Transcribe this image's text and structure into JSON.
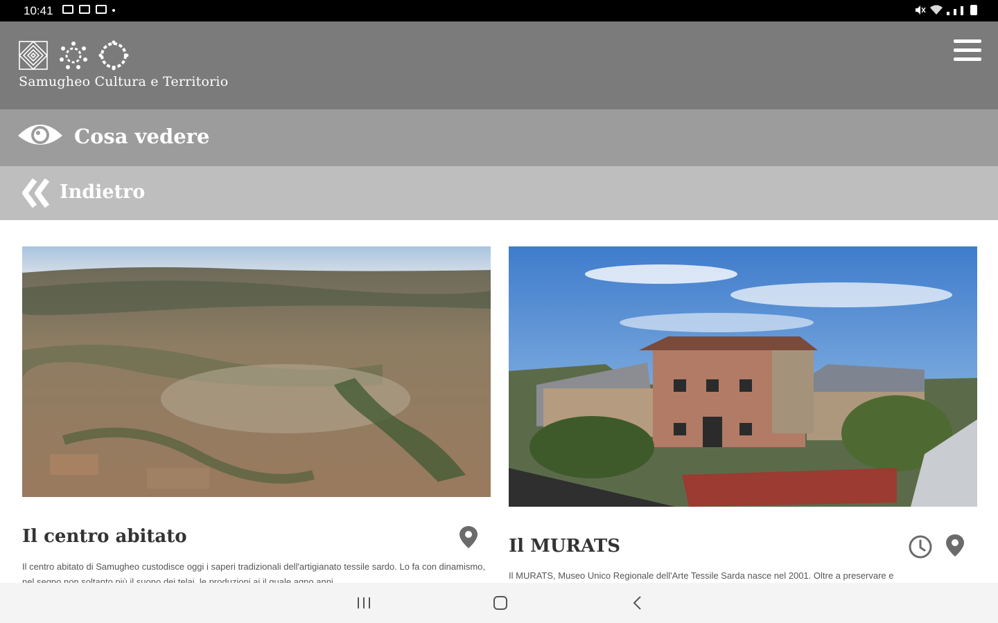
{
  "status_bar": {
    "time": "10:41"
  },
  "header": {
    "app_title": "Samugheo Cultura e Territorio"
  },
  "section": {
    "title": "Cosa vedere"
  },
  "back": {
    "label": "Indietro"
  },
  "cards": [
    {
      "title": "Il centro abitato",
      "description": "Il centro abitato di Samugheo custodisce oggi i saperi tradizionali dell'artigianato tessile sardo. Lo fa con dinamismo, nel segno non soltanto più il suono dei telai, le produzioni ai il quale agno anni"
    },
    {
      "title": "Il MURATS",
      "description": "Il MURATS, Museo Unico Regionale dell'Arte Tessile Sarda nasce nel 2001. Oltre a preservare e"
    }
  ],
  "colors": {
    "header": "#7b7b7b",
    "section_bar": "#9c9c9c",
    "back_bar": "#bebebe"
  }
}
